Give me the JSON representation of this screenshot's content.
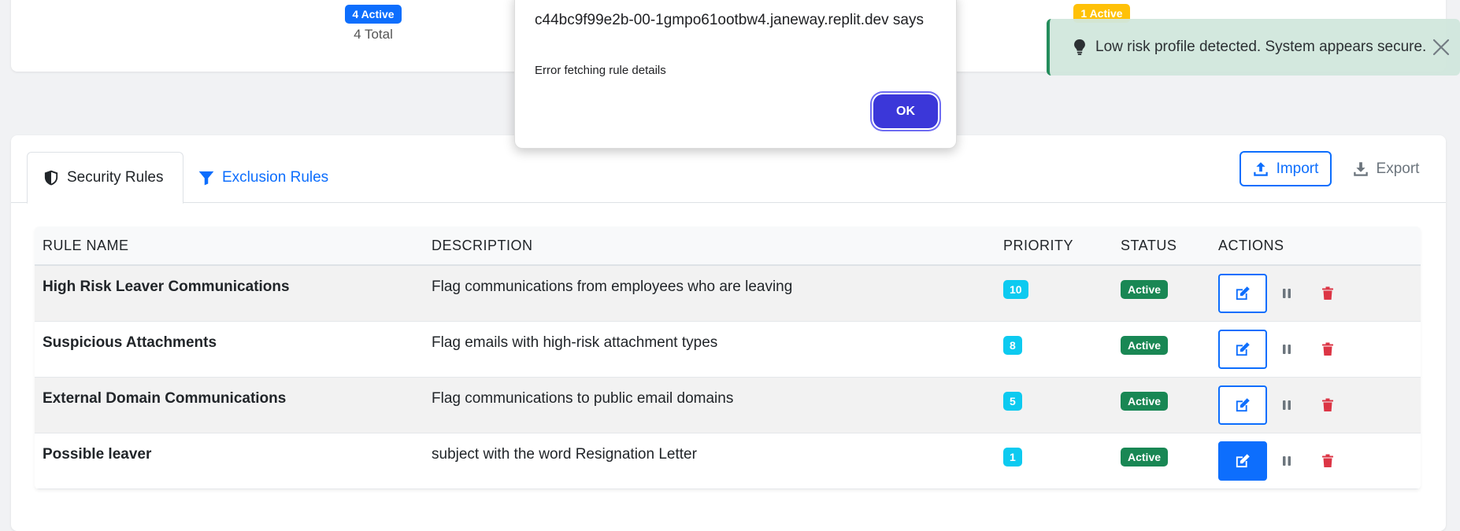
{
  "summary": {
    "active_badge": "4 Active",
    "total": "4 Total",
    "warn_badge": "1 Active"
  },
  "toast": {
    "message": "Low risk profile detected. System appears secure."
  },
  "dialog": {
    "host": "c44bc9f99e2b-00-1gmpo61ootbw4.janeway.replit.dev says",
    "message": "Error fetching rule details",
    "ok_label": "OK"
  },
  "tabs": [
    {
      "label": "Security Rules",
      "icon": "shield-icon",
      "active": true
    },
    {
      "label": "Exclusion Rules",
      "icon": "filter-icon",
      "active": false
    }
  ],
  "toolbar": {
    "import_label": "Import",
    "export_label": "Export"
  },
  "table": {
    "headers": [
      "RULE NAME",
      "DESCRIPTION",
      "PRIORITY",
      "STATUS",
      "ACTIONS"
    ],
    "rows": [
      {
        "name": "High Risk Leaver Communications",
        "description": "Flag communications from employees who are leaving",
        "priority": "10",
        "status": "Active"
      },
      {
        "name": "Suspicious Attachments",
        "description": "Flag emails with high-risk attachment types",
        "priority": "8",
        "status": "Active"
      },
      {
        "name": "External Domain Communications",
        "description": "Flag communications to public email domains",
        "priority": "5",
        "status": "Active"
      },
      {
        "name": "Possible leaver",
        "description": "subject with the word Resignation Letter",
        "priority": "1",
        "status": "Active"
      }
    ]
  },
  "colors": {
    "primary": "#0d6efd",
    "success": "#198754",
    "info": "#0dcaf0",
    "warning": "#ffc107",
    "danger": "#dc3545",
    "dialog_button": "#3b37d9"
  }
}
